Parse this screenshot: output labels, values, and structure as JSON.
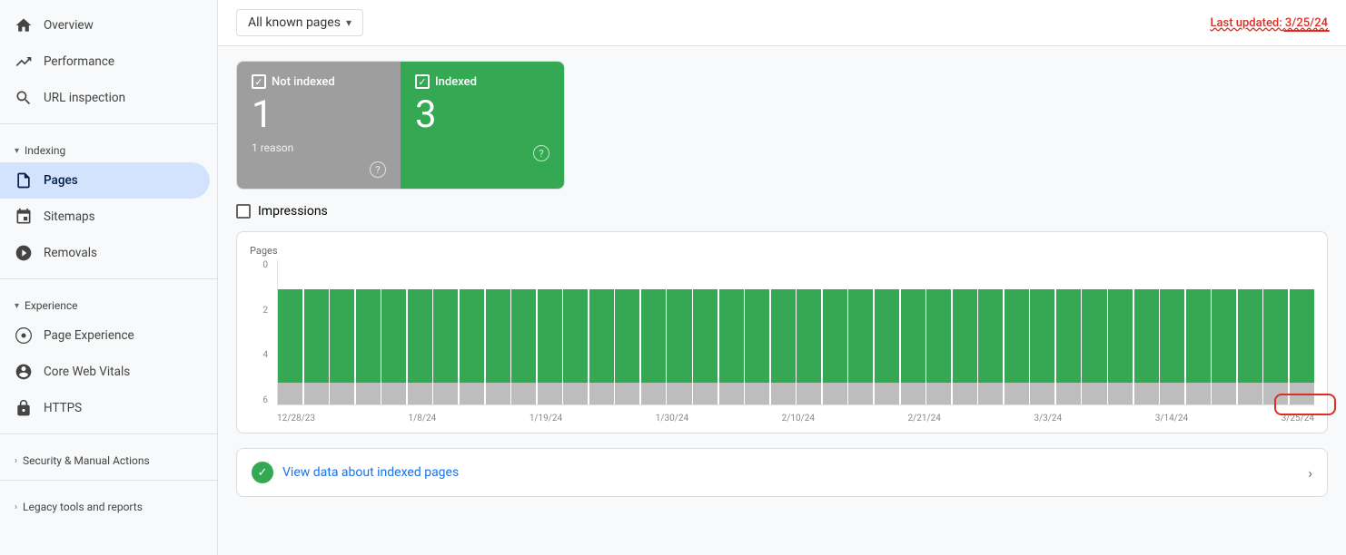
{
  "sidebar": {
    "items": [
      {
        "id": "overview",
        "label": "Overview",
        "icon": "home"
      },
      {
        "id": "performance",
        "label": "Performance",
        "icon": "trending-up"
      },
      {
        "id": "url-inspection",
        "label": "URL inspection",
        "icon": "search"
      }
    ],
    "indexing_section": "Indexing",
    "indexing_items": [
      {
        "id": "pages",
        "label": "Pages",
        "icon": "pages",
        "active": true
      },
      {
        "id": "sitemaps",
        "label": "Sitemaps",
        "icon": "sitemaps"
      },
      {
        "id": "removals",
        "label": "Removals",
        "icon": "removals"
      }
    ],
    "experience_section": "Experience",
    "experience_items": [
      {
        "id": "page-experience",
        "label": "Page Experience",
        "icon": "page-experience"
      },
      {
        "id": "core-web-vitals",
        "label": "Core Web Vitals",
        "icon": "core-web-vitals"
      },
      {
        "id": "https",
        "label": "HTTPS",
        "icon": "https"
      }
    ],
    "security_section": "Security & Manual Actions",
    "legacy_section": "Legacy tools and reports"
  },
  "topbar": {
    "dropdown_label": "All known pages",
    "last_updated_prefix": "Last updated: ",
    "last_updated_date": "3/25/24"
  },
  "cards": {
    "not_indexed": {
      "label": "Not indexed",
      "count": "1",
      "sub": "1 reason"
    },
    "indexed": {
      "label": "Indexed",
      "count": "3"
    }
  },
  "impressions": {
    "label": "Impressions"
  },
  "chart": {
    "y_label": "Pages",
    "y_values": [
      "6",
      "4",
      "2",
      "0"
    ],
    "x_labels": [
      "12/28/23",
      "1/8/24",
      "1/19/24",
      "1/30/24",
      "2/10/24",
      "2/21/24",
      "3/3/24",
      "3/14/24",
      "3/25/24"
    ],
    "green_height_pct": 65,
    "gray_height_pct": 15,
    "bar_count": 40
  },
  "view_indexed": {
    "text": "View data about indexed pages"
  }
}
